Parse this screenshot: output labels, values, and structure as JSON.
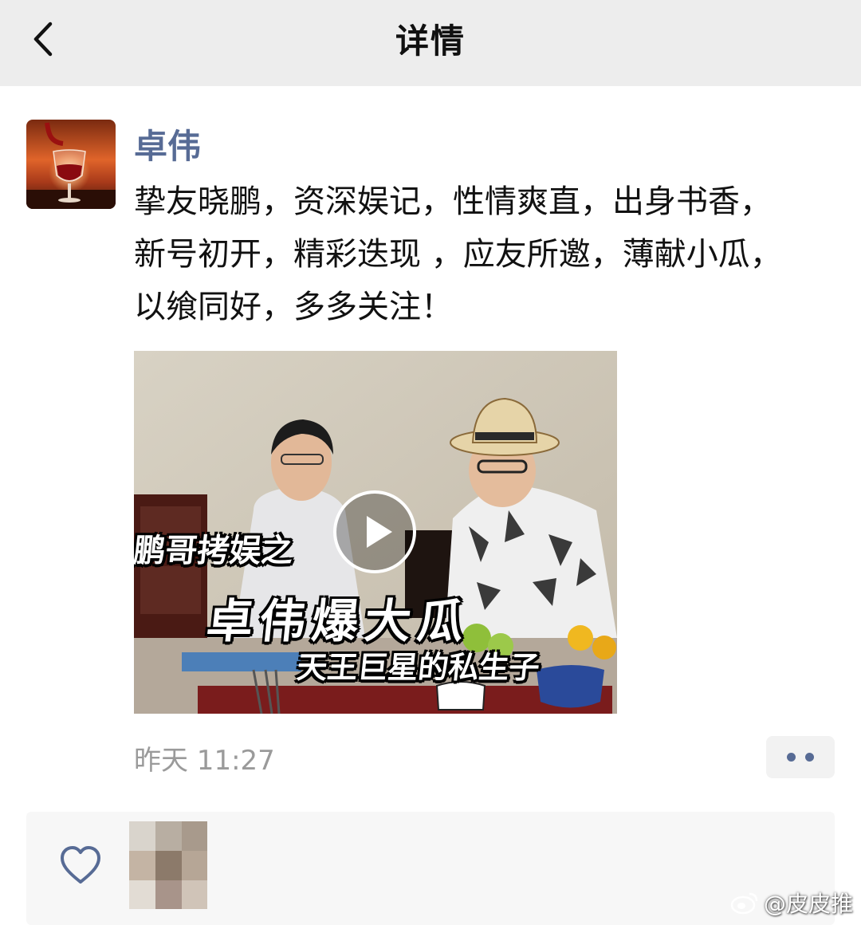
{
  "header": {
    "title": "详情",
    "back_icon": "chevron-left-icon"
  },
  "post": {
    "author": "卓伟",
    "text_lines": [
      "挚友晓鹏，资深娱记，性情爽直，出身书香，",
      "新号初开，精彩迭现 ，应友所邀，薄献小瓜，",
      "以飨同好，多多关注！"
    ],
    "video": {
      "caption_line1": "鹏哥拷娱之",
      "caption_line2": "卓伟爆大瓜",
      "caption_line3": "天王巨星的私生子",
      "play_icon": "play-icon"
    },
    "timestamp": "昨天 11:27",
    "more_icon": "more-dots-icon"
  },
  "likes": {
    "like_icon": "heart-outline-icon"
  },
  "watermark": {
    "text": "@皮皮推"
  },
  "colors": {
    "header_bg": "#ededed",
    "author_name": "#576b95",
    "timestamp": "#9a9a9a",
    "likes_bg": "#f7f7f7"
  }
}
